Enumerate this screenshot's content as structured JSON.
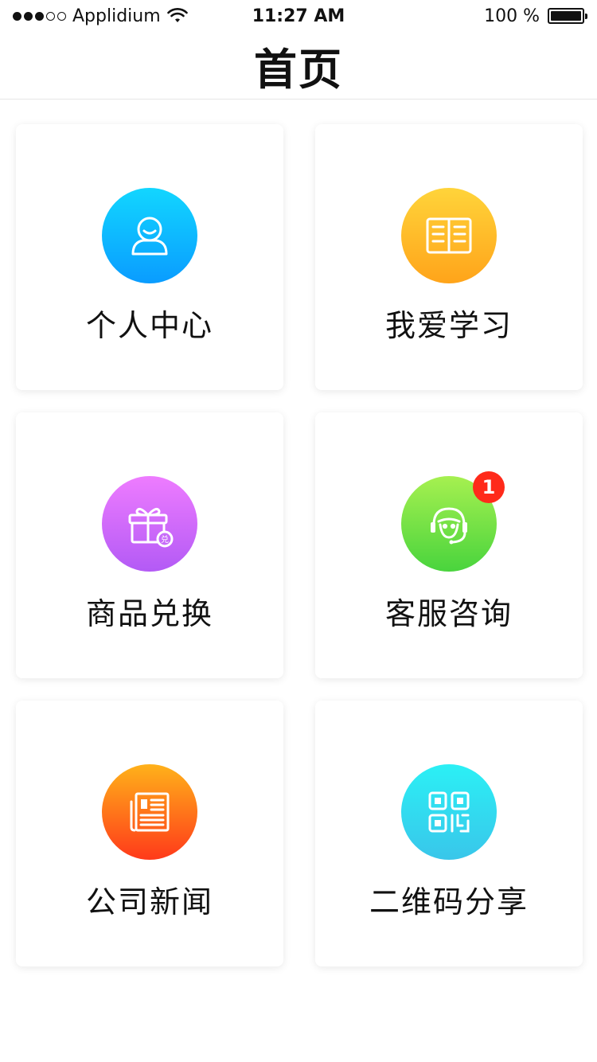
{
  "status_bar": {
    "carrier": "Applidium",
    "time": "11:27 AM",
    "battery": "100 %",
    "signal_bars": 3,
    "signal_total": 5
  },
  "nav": {
    "title": "首页"
  },
  "menu": [
    {
      "label": "个人中心",
      "icon": "user-icon",
      "colors": [
        "#12d6ff",
        "#0a9cff"
      ]
    },
    {
      "label": "我爱学习",
      "icon": "book-icon",
      "colors": [
        "#ffd43a",
        "#ffa41a"
      ]
    },
    {
      "label": "商品兑换",
      "icon": "gift-icon",
      "colors": [
        "#ee7cff",
        "#b35af5"
      ]
    },
    {
      "label": "客服咨询",
      "icon": "headset-icon",
      "colors": [
        "#a6f050",
        "#49d43d"
      ],
      "badge": "1"
    },
    {
      "label": "公司新闻",
      "icon": "newspaper-icon",
      "colors": [
        "#ffb21a",
        "#ff3a1a"
      ]
    },
    {
      "label": "二维码分享",
      "icon": "qrcode-icon",
      "colors": [
        "#2bf0f5",
        "#39c6ea"
      ]
    }
  ]
}
